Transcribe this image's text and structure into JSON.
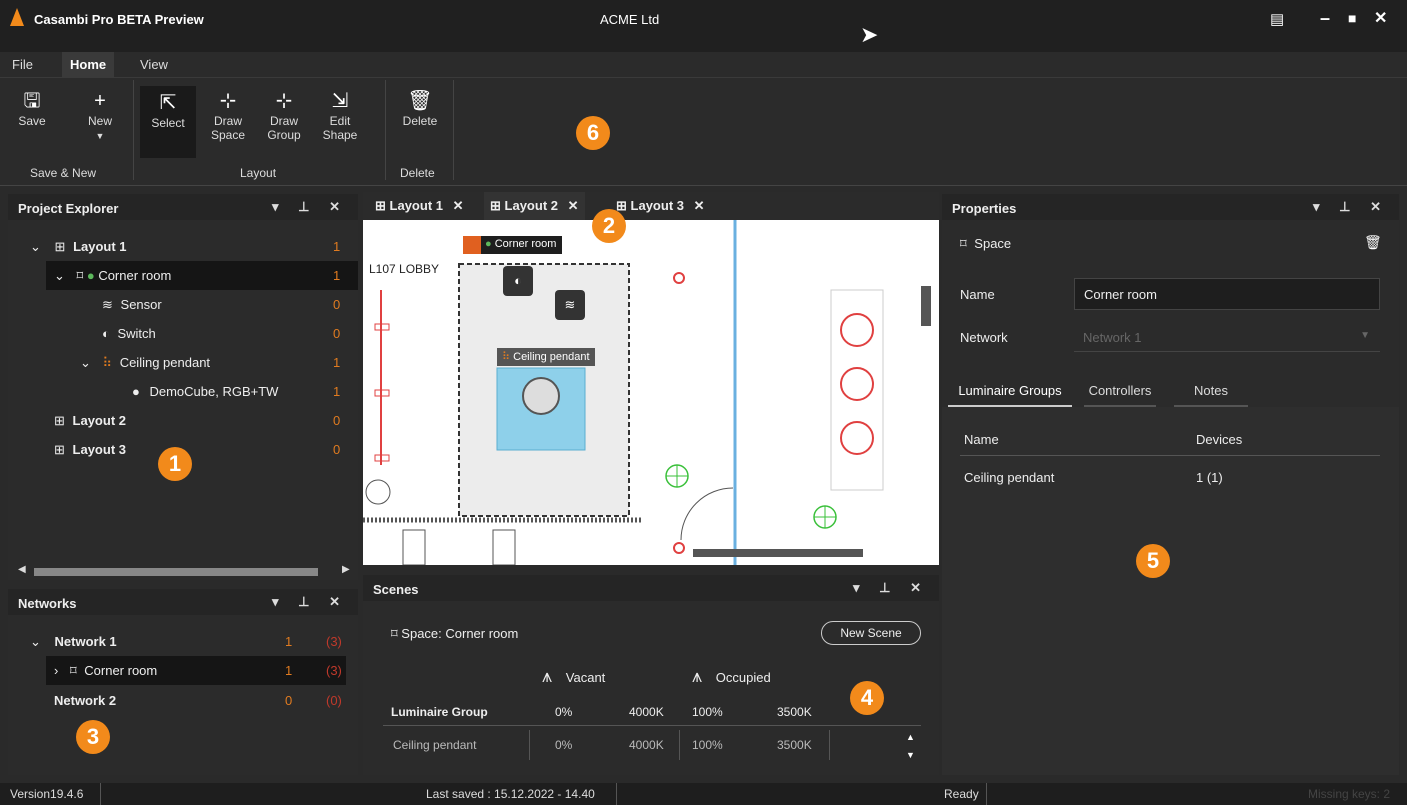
{
  "app": {
    "title": "Casambi Pro BETA Preview",
    "org": "ACME Ltd"
  },
  "menu": {
    "file": "File",
    "home": "Home",
    "view": "View"
  },
  "ribbon": {
    "save": "Save",
    "new": "New",
    "select": "Select",
    "draw_space_1": "Draw",
    "draw_space_2": "Space",
    "draw_group_1": "Draw",
    "draw_group_2": "Group",
    "edit_shape_1": "Edit",
    "edit_shape_2": "Shape",
    "delete": "Delete",
    "group_save_new": "Save & New",
    "group_layout": "Layout",
    "group_delete": "Delete"
  },
  "project_explorer": {
    "title": "Project Explorer",
    "items": [
      {
        "label": "Layout 1",
        "count": "1"
      },
      {
        "label": "Corner room",
        "count": "1"
      },
      {
        "label": "Sensor",
        "count": "0"
      },
      {
        "label": "Switch",
        "count": "0"
      },
      {
        "label": "Ceiling pendant",
        "count": "1"
      },
      {
        "label": "DemoCube, RGB+TW",
        "count": "1"
      },
      {
        "label": "Layout 2",
        "count": "0"
      },
      {
        "label": "Layout 3",
        "count": "0"
      }
    ]
  },
  "networks": {
    "title": "Networks",
    "items": [
      {
        "label": "Network 1",
        "count": "1",
        "total": "(3)"
      },
      {
        "label": "Corner room",
        "count": "1",
        "total": "(3)"
      },
      {
        "label": "Network 2",
        "count": "0",
        "total": "(0)"
      }
    ]
  },
  "tabs": [
    {
      "label": "Layout 1"
    },
    {
      "label": "Layout 2"
    },
    {
      "label": "Layout 3"
    }
  ],
  "canvas": {
    "lobby": "L107 LOBBY",
    "room_tag": "Corner room",
    "pendant_tag": "Ceiling pendant"
  },
  "scenes": {
    "title": "Scenes",
    "space_label": "Space:  Corner room",
    "new_scene": "New Scene",
    "vacant": "Vacant",
    "occupied": "Occupied",
    "header": {
      "group": "Luminaire Group",
      "v_pct": "0%",
      "v_k": "4000K",
      "o_pct": "100%",
      "o_k": "3500K"
    },
    "row": {
      "group": "Ceiling pendant",
      "v_pct": "0%",
      "v_k": "4000K",
      "o_pct": "100%",
      "o_k": "3500K"
    }
  },
  "properties": {
    "title": "Properties",
    "type": "Space",
    "name_label": "Name",
    "name_value": "Corner room",
    "network_label": "Network",
    "network_value": "Network 1",
    "tabs": [
      "Luminaire Groups",
      "Controllers",
      "Notes"
    ],
    "col_name": "Name",
    "col_devices": "Devices",
    "row_name": "Ceiling pendant",
    "row_devices": "1  (1)"
  },
  "badges": [
    "1",
    "2",
    "3",
    "4",
    "5",
    "6"
  ],
  "status": {
    "version": "Version19.4.6",
    "saved": "Last saved : 15.12.2022 - 14.40",
    "ready": "Ready",
    "missing": "Missing keys: 2"
  },
  "colors": {
    "accent": "#f28a1b",
    "count": "#e07b20",
    "red": "#c0392b"
  }
}
